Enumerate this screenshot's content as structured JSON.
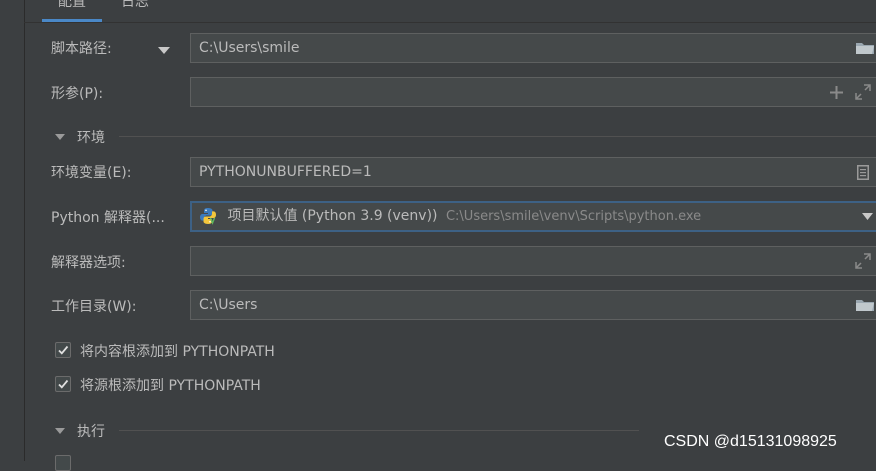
{
  "tabs": [
    {
      "label": "配置",
      "active": true
    },
    {
      "label": "日志",
      "active": false
    }
  ],
  "script_path": {
    "label": "脚本路径:",
    "value": "C:\\Users\\smile"
  },
  "parameters": {
    "label": "形参(P):",
    "value": ""
  },
  "env_section": {
    "title": "环境"
  },
  "env_vars": {
    "label": "环境变量(E):",
    "value": "PYTHONUNBUFFERED=1"
  },
  "interpreter": {
    "label": "Python 解释器(...",
    "name": "项目默认值 (Python 3.9 (venv))",
    "path": "C:\\Users\\smile\\venv\\Scripts\\python.exe"
  },
  "interpreter_options": {
    "label": "解释器选项:",
    "value": ""
  },
  "working_dir": {
    "label": "工作目录(W):",
    "value": "C:\\Users"
  },
  "checkboxes": [
    {
      "label": "将内容根添加到 PYTHONPATH",
      "checked": true
    },
    {
      "label": "将源根添加到 PYTHONPATH",
      "checked": true
    }
  ],
  "exec_section": {
    "title": "执行"
  },
  "watermark": "CSDN @d15131098925",
  "colors": {
    "background": "#3c3f41",
    "field": "#45494a",
    "focus": "#3d6185",
    "accent": "#4a88c7"
  }
}
